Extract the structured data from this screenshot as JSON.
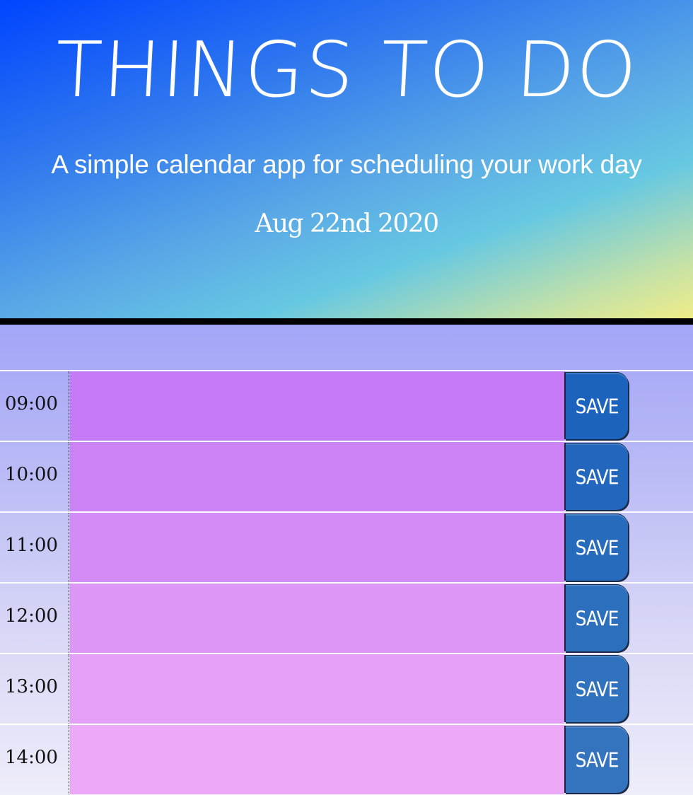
{
  "header": {
    "title": "THINGS TO DO",
    "lead": "A simple calendar app for scheduling your work day",
    "current_date": "Aug 22nd 2020"
  },
  "colors": {
    "present_past_block": "#c37cf6",
    "save_button": "#1f63bf"
  },
  "schedule": {
    "rows": [
      {
        "hour": "09:00",
        "task_value": "",
        "save_label": "SAVE",
        "task_color": "#c47bf5",
        "save_color": "#1c63bd"
      },
      {
        "hour": "10:00",
        "task_value": "",
        "save_label": "SAVE",
        "task_color": "#cb82f5",
        "save_color": "#2266bd"
      },
      {
        "hour": "11:00",
        "task_value": "",
        "save_label": "SAVE",
        "task_color": "#d38cf5",
        "save_color": "#276bbd"
      },
      {
        "hour": "12:00",
        "task_value": "",
        "save_label": "SAVE",
        "task_color": "#dc96f6",
        "save_color": "#2c6fbd"
      },
      {
        "hour": "13:00",
        "task_value": "",
        "save_label": "SAVE",
        "task_color": "#e49ff7",
        "save_color": "#3072be"
      },
      {
        "hour": "14:00",
        "task_value": "",
        "save_label": "SAVE",
        "task_color": "#eca9f8",
        "save_color": "#3474be"
      }
    ]
  }
}
